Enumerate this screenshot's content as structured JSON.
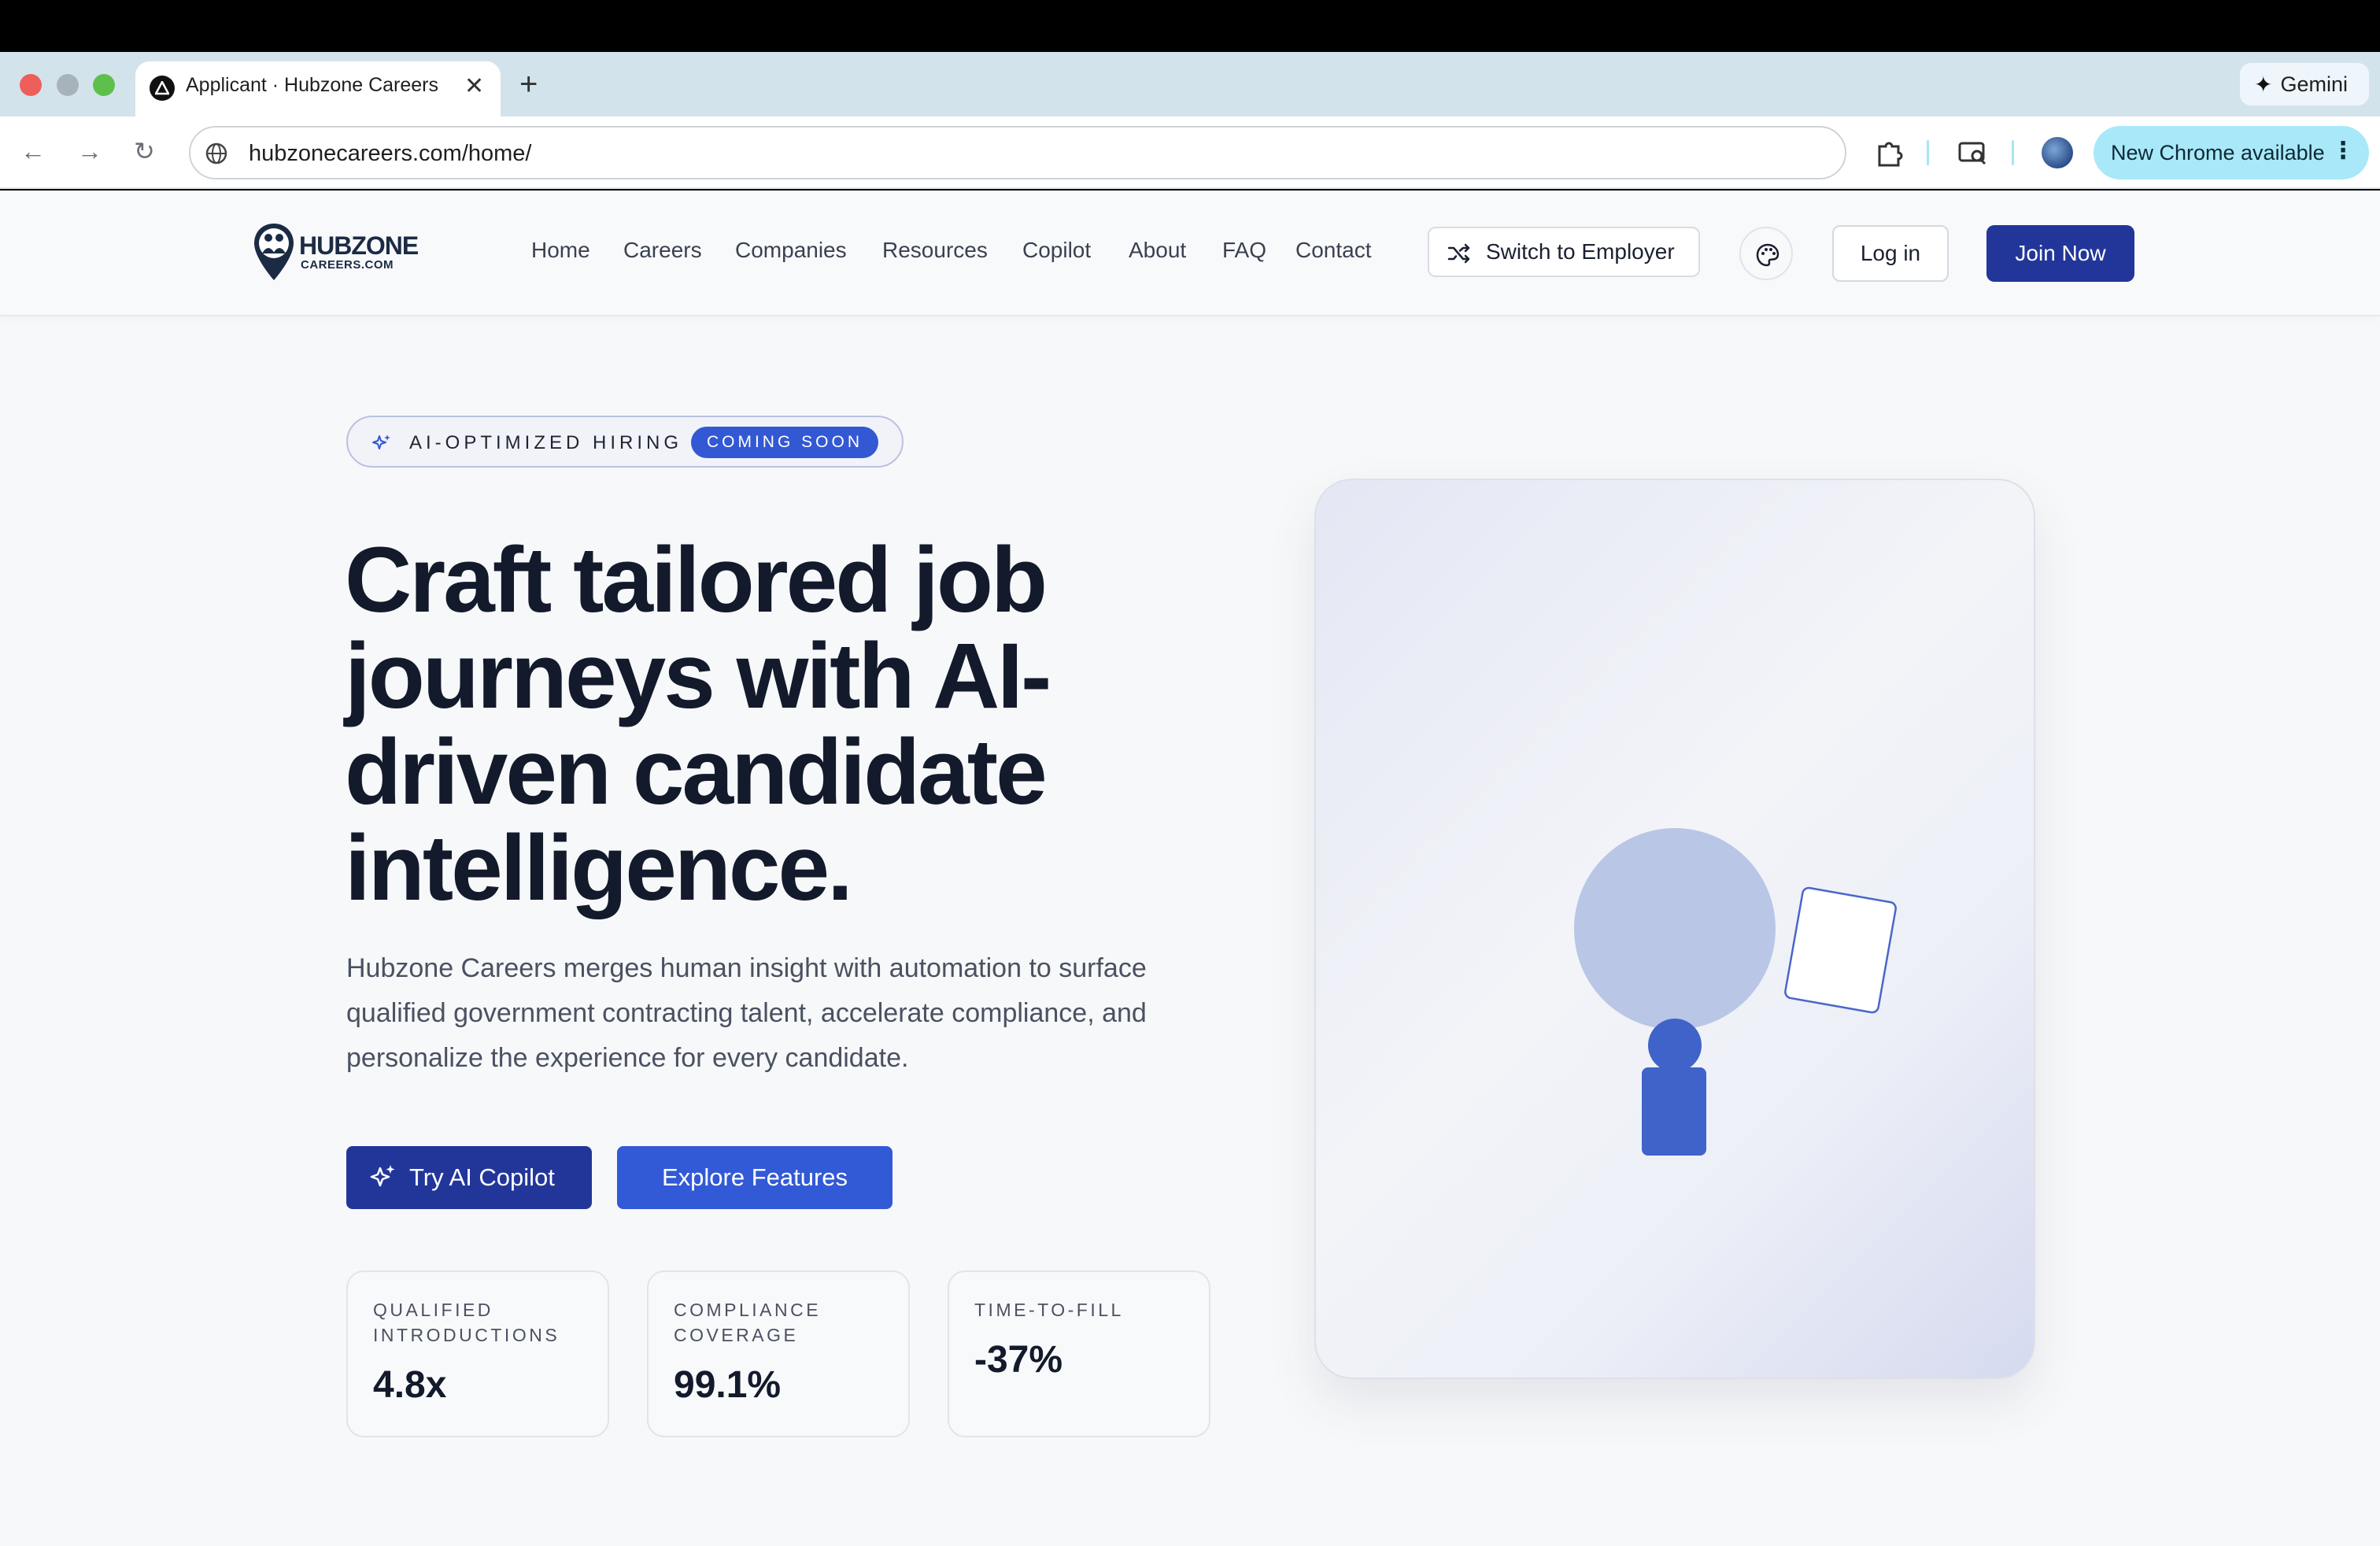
{
  "browser": {
    "tab_title": "Applicant · Hubzone Careers",
    "tab_close": "✕",
    "new_tab": "+",
    "gemini_label": "Gemini",
    "url": "hubzonecareers.com/home/",
    "update_label": "New Chrome available",
    "back_icon": "←",
    "forward_icon": "→",
    "reload_icon": "↻",
    "menu_icon": "⋮"
  },
  "site": {
    "logo_word": "HUBZONE",
    "logo_sub": "CAREERS.COM",
    "nav": [
      "Home",
      "Careers",
      "Companies",
      "Resources",
      "Copilot",
      "About",
      "FAQ",
      "Contact"
    ],
    "switch_label": "Switch to Employer",
    "login_label": "Log in",
    "join_label": "Join Now"
  },
  "hero": {
    "pill_text": "AI-OPTIMIZED HIRING",
    "pill_badge": "COMING SOON",
    "headline": "Craft tailored job journeys with AI-driven candidate intelligence.",
    "lead": "Hubzone Careers merges human insight with automation to surface qualified government contracting talent, accelerate compliance, and personalize the experience for every candidate.",
    "cta_primary": "Try AI Copilot",
    "cta_secondary": "Explore Features"
  },
  "stats": [
    {
      "label": "QUALIFIED INTRODUCTIONS",
      "value": "4.8x"
    },
    {
      "label": "COMPLIANCE COVERAGE",
      "value": "99.1%"
    },
    {
      "label": "TIME-TO-FILL",
      "value": "-37%"
    }
  ],
  "colors": {
    "brand_primary": "#22369a",
    "brand_accent": "#3259d6",
    "heading": "#131a2b"
  }
}
